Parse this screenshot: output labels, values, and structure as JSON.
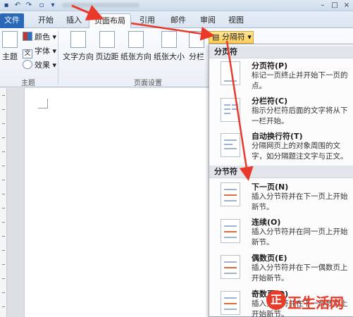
{
  "tabs": [
    "文件",
    "开始",
    "插入",
    "页面布局",
    "引用",
    "邮件",
    "审阅",
    "视图"
  ],
  "ribbon": {
    "theme_group": {
      "label": "主题",
      "big_button": "主题",
      "colors": "颜色",
      "fonts": "字体",
      "effects": "效果"
    },
    "page_setup_group": {
      "label": "页面设置",
      "buttons": [
        "文字方向",
        "页边距",
        "纸张方向",
        "纸张大小",
        "分栏"
      ]
    }
  },
  "breaks_button": {
    "label": "分隔符"
  },
  "menu": {
    "page_breaks_header": "分页符",
    "page_breaks": [
      {
        "title": "分页符(P)",
        "desc": "标记一页终止并开始下一页的点。"
      },
      {
        "title": "分栏符(C)",
        "desc": "指示分栏符后面的文字将从下一栏开始。"
      },
      {
        "title": "自动换行符(T)",
        "desc": "分隔网页上的对象周围的文字，如分隔题注文字与正文。"
      }
    ],
    "section_breaks_header": "分节符",
    "section_breaks": [
      {
        "title": "下一页(N)",
        "desc": "插入分节符并在下一页上开始新节。"
      },
      {
        "title": "连续(O)",
        "desc": "插入分节符并在同一页上开始新节。"
      },
      {
        "title": "偶数页(E)",
        "desc": "插入分节符并在下一偶数页上开始新节。"
      },
      {
        "title": "奇数页(D)",
        "desc": "插入分节符并在下一奇数页上开始新节。"
      }
    ]
  },
  "watermark": {
    "text": "正生活网",
    "seal": "正"
  },
  "colors": {
    "accent": "#2a68b8",
    "arrow": "#e8392a",
    "highlight": "#ffcf5a"
  }
}
